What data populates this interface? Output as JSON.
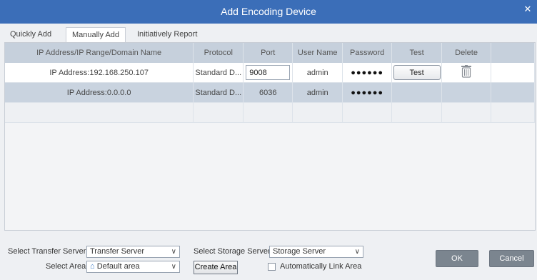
{
  "window": {
    "title": "Add Encoding Device"
  },
  "tabs": [
    {
      "label": "Quickly Add",
      "active": false
    },
    {
      "label": "Manually Add",
      "active": true
    },
    {
      "label": "Initiatively Report",
      "active": false
    }
  ],
  "table": {
    "headers": [
      "IP Address/IP Range/Domain Name",
      "Protocol",
      "Port",
      "User Name",
      "Password",
      "Test",
      "Delete"
    ],
    "rows": [
      {
        "address": "IP Address:192.168.250.107",
        "protocol": "Standard D...",
        "port": "9008",
        "username": "admin",
        "password": "●●●●●●",
        "test_label": "Test"
      },
      {
        "address": "IP Address:0.0.0.0",
        "protocol": "Standard D...",
        "port": "6036",
        "username": "admin",
        "password": "●●●●●●"
      }
    ]
  },
  "footer": {
    "transfer_label": "Select Transfer Server",
    "transfer_value": "Transfer Server",
    "storage_label": "Select Storage Server",
    "storage_value": "Storage Server",
    "area_label": "Select Area",
    "area_value": "Default area",
    "create_area": "Create Area",
    "auto_link": "Automatically Link Area",
    "auto_link_checked": false,
    "ok": "OK",
    "cancel": "Cancel"
  },
  "icons": {
    "close": "close-icon",
    "home": "home-icon",
    "delete": "trash-icon",
    "dropdown": "chevron-down-icon"
  },
  "colors": {
    "titlebar": "#3b6eb8",
    "header_row": "#c6d0dc",
    "selected_row": "#c9d3df"
  }
}
